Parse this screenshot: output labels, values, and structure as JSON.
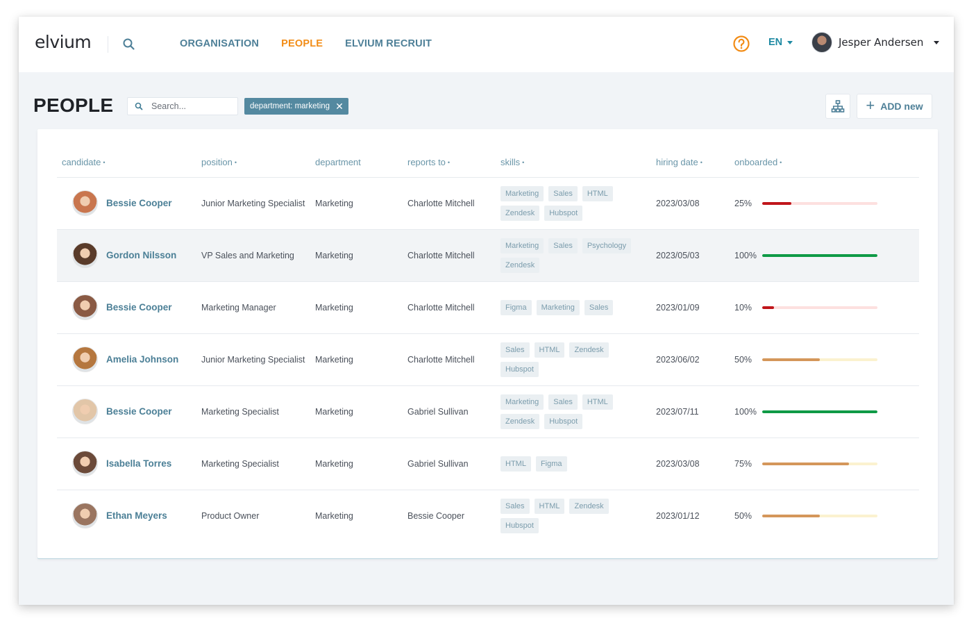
{
  "app": {
    "logo": "elvium",
    "nav": [
      {
        "label": "ORGANISATION",
        "active": false
      },
      {
        "label": "PEOPLE",
        "active": true
      },
      {
        "label": "ELVIUM RECRUIT",
        "active": false
      }
    ],
    "language": "EN",
    "user_name": "Jesper Andersen",
    "colors": {
      "accent": "#f28c16",
      "nav": "#4d7f97",
      "lang": "#1f8aa3"
    }
  },
  "page": {
    "title": "PEOPLE",
    "search_placeholder": "Search...",
    "search_value": "",
    "filter_chip": "department: marketing",
    "add_label": "ADD new"
  },
  "table": {
    "columns": [
      {
        "label": "candidate",
        "sortable": true
      },
      {
        "label": "position",
        "sortable": true
      },
      {
        "label": "department",
        "sortable": false
      },
      {
        "label": "reports to",
        "sortable": true
      },
      {
        "label": "skills",
        "sortable": true
      },
      {
        "label": "hiring date",
        "sortable": true
      },
      {
        "label": "onboarded",
        "sortable": true
      }
    ],
    "rows": [
      {
        "name": "Bessie Cooper",
        "position": "Junior Marketing Specialist",
        "department": "Marketing",
        "reports_to": "Charlotte Mitchell",
        "skills": [
          "Marketing",
          "Sales",
          "HTML",
          "Zendesk",
          "Hubspot"
        ],
        "hiring_date": "2023/03/08",
        "onboarded_label": "25%",
        "onboarded": 25,
        "status": "low",
        "highlighted": false,
        "avatar_color": "#c9764e"
      },
      {
        "name": "Gordon Nilsson",
        "position": "VP Sales and Marketing",
        "department": "Marketing",
        "reports_to": "Charlotte Mitchell",
        "skills": [
          "Marketing",
          "Sales",
          "Psychology",
          "Zendesk"
        ],
        "hiring_date": "2023/05/03",
        "onboarded_label": "100%",
        "onboarded": 100,
        "status": "done",
        "highlighted": true,
        "avatar_color": "#5a3b2a"
      },
      {
        "name": "Bessie Cooper",
        "position": "Marketing Manager",
        "department": "Marketing",
        "reports_to": "Charlotte Mitchell",
        "skills": [
          "Figma",
          "Marketing",
          "Sales"
        ],
        "hiring_date": "2023/01/09",
        "onboarded_label": "10%",
        "onboarded": 10,
        "status": "low",
        "highlighted": false,
        "avatar_color": "#8a5a44"
      },
      {
        "name": "Amelia Johnson",
        "position": "Junior Marketing Specialist",
        "department": "Marketing",
        "reports_to": "Charlotte Mitchell",
        "skills": [
          "Sales",
          "HTML",
          "Zendesk",
          "Hubspot"
        ],
        "hiring_date": "2023/06/02",
        "onboarded_label": "50%",
        "onboarded": 50,
        "status": "mid",
        "highlighted": false,
        "avatar_color": "#b5773f"
      },
      {
        "name": "Bessie Cooper",
        "position": "Marketing Specialist",
        "department": "Marketing",
        "reports_to": "Gabriel Sullivan",
        "skills": [
          "Marketing",
          "Sales",
          "HTML",
          "Zendesk",
          "Hubspot"
        ],
        "hiring_date": "2023/07/11",
        "onboarded_label": "100%",
        "onboarded": 100,
        "status": "done",
        "highlighted": false,
        "avatar_color": "#e2c6a8"
      },
      {
        "name": "Isabella Torres",
        "position": "Marketing Specialist",
        "department": "Marketing",
        "reports_to": "Gabriel Sullivan",
        "skills": [
          "HTML",
          "Figma"
        ],
        "hiring_date": "2023/03/08",
        "onboarded_label": "75%",
        "onboarded": 75,
        "status": "mid",
        "highlighted": false,
        "avatar_color": "#6b4a39"
      },
      {
        "name": "Ethan Meyers",
        "position": "Product Owner",
        "department": "Marketing",
        "reports_to": "Bessie Cooper",
        "skills": [
          "Sales",
          "HTML",
          "Zendesk",
          "Hubspot"
        ],
        "hiring_date": "2023/01/12",
        "onboarded_label": "50%",
        "onboarded": 50,
        "status": "mid",
        "highlighted": false,
        "avatar_color": "#9a7560"
      }
    ],
    "status_colors": {
      "low": {
        "fill": "#c0161b",
        "track": "#fde0df"
      },
      "mid": {
        "fill": "#d4965a",
        "track": "#fbf2cf"
      },
      "done": {
        "fill": "#0f9a46",
        "track": "#d9f2e2"
      }
    }
  }
}
